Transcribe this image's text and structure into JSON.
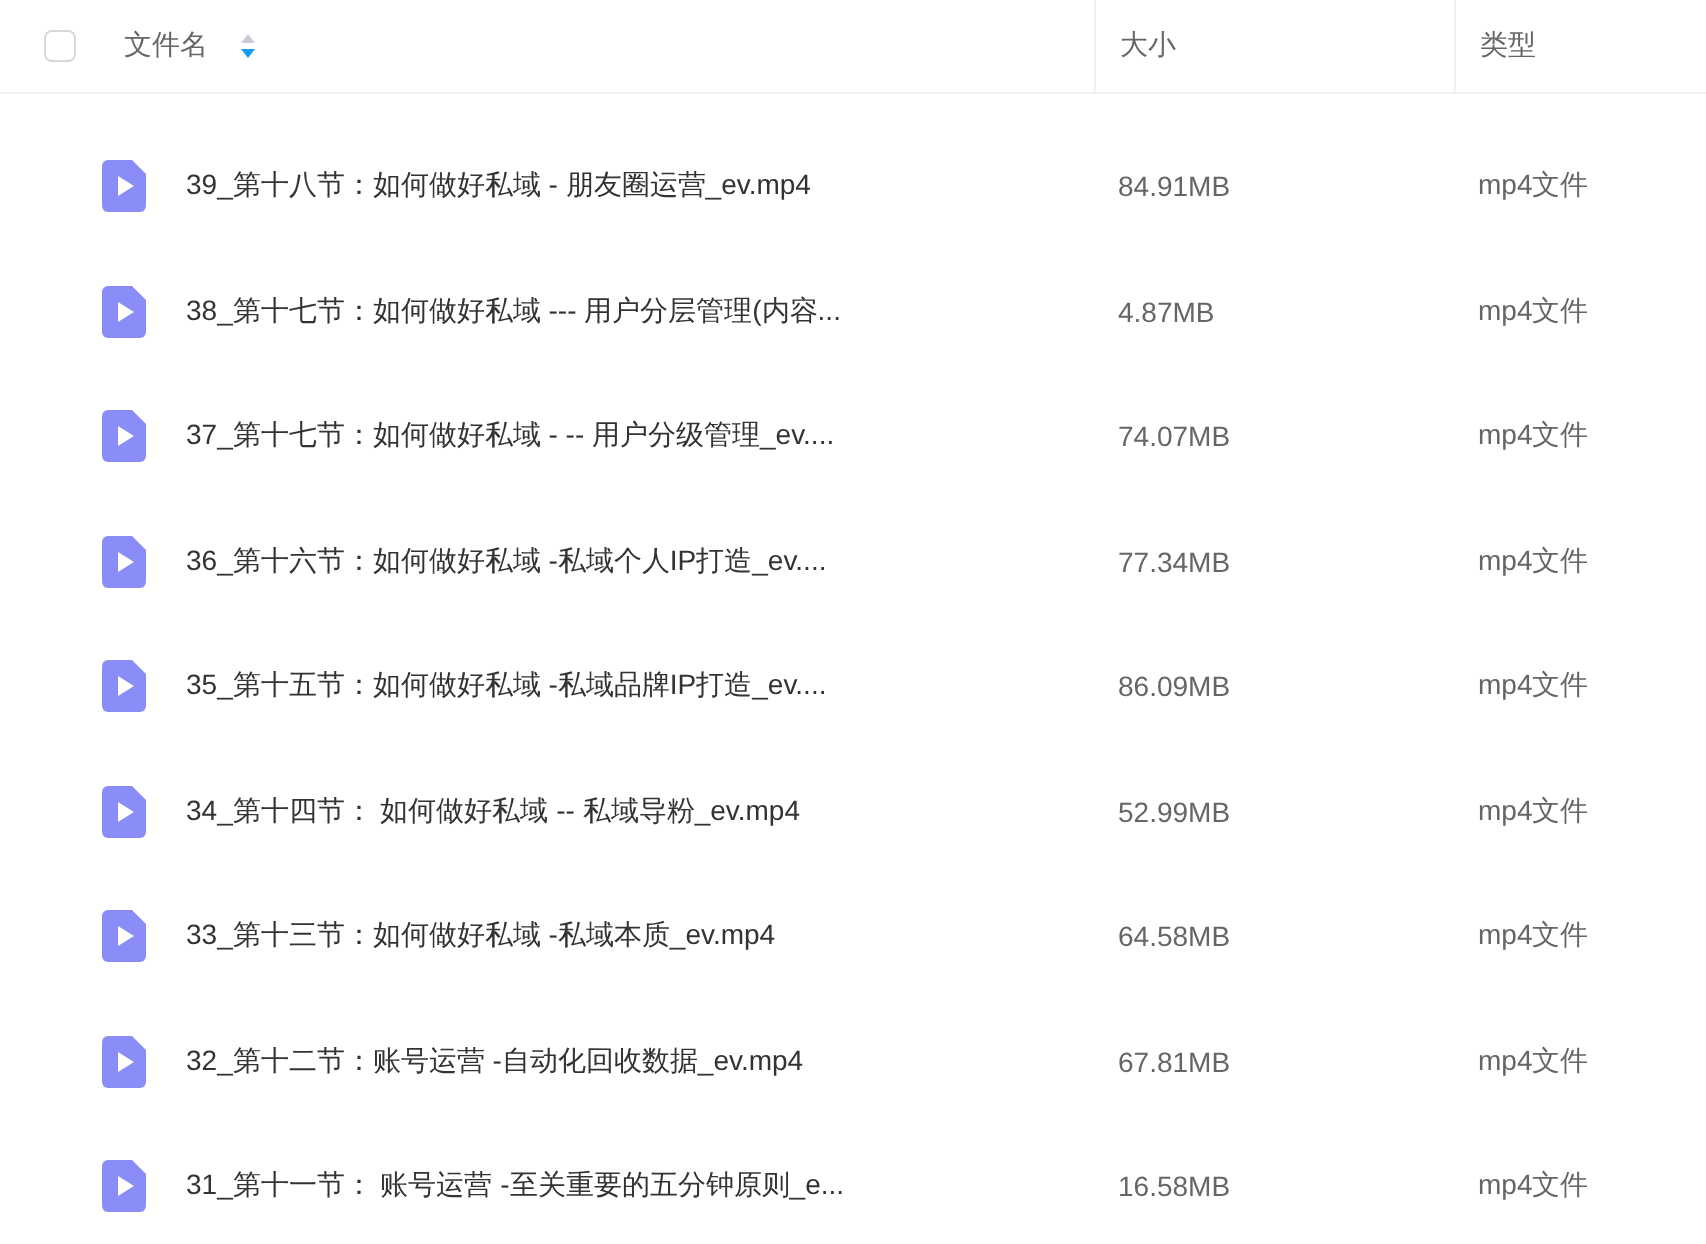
{
  "header": {
    "select_all": {
      "checked": false
    },
    "columns": [
      {
        "label": "文件名",
        "sort_descending": true
      },
      {
        "label": "大小"
      },
      {
        "label": "类型"
      }
    ]
  },
  "rows": [
    {
      "name": "39_第十八节：如何做好私域 - 朋友圈运营_ev.mp4",
      "size": "84.91MB",
      "type": "mp4文件"
    },
    {
      "name": "38_第十七节：如何做好私域 --- 用户分层管理(内容...",
      "size": "4.87MB",
      "type": "mp4文件"
    },
    {
      "name": "37_第十七节：如何做好私域 - -- 用户分级管理_ev....",
      "size": "74.07MB",
      "type": "mp4文件"
    },
    {
      "name": "36_第十六节：如何做好私域 -私域个人IP打造_ev....",
      "size": "77.34MB",
      "type": "mp4文件"
    },
    {
      "name": "35_第十五节：如何做好私域 -私域品牌IP打造_ev....",
      "size": "86.09MB",
      "type": "mp4文件"
    },
    {
      "name": "34_第十四节： 如何做好私域 -- 私域导粉_ev.mp4",
      "size": "52.99MB",
      "type": "mp4文件"
    },
    {
      "name": "33_第十三节：如何做好私域 -私域本质_ev.mp4",
      "size": "64.58MB",
      "type": "mp4文件"
    },
    {
      "name": "32_第十二节：账号运营 -自动化回收数据_ev.mp4",
      "size": "67.81MB",
      "type": "mp4文件"
    },
    {
      "name": "31_第十一节： 账号运营 -至关重要的五分钟原则_e...",
      "size": "16.58MB",
      "type": "mp4文件"
    }
  ]
}
